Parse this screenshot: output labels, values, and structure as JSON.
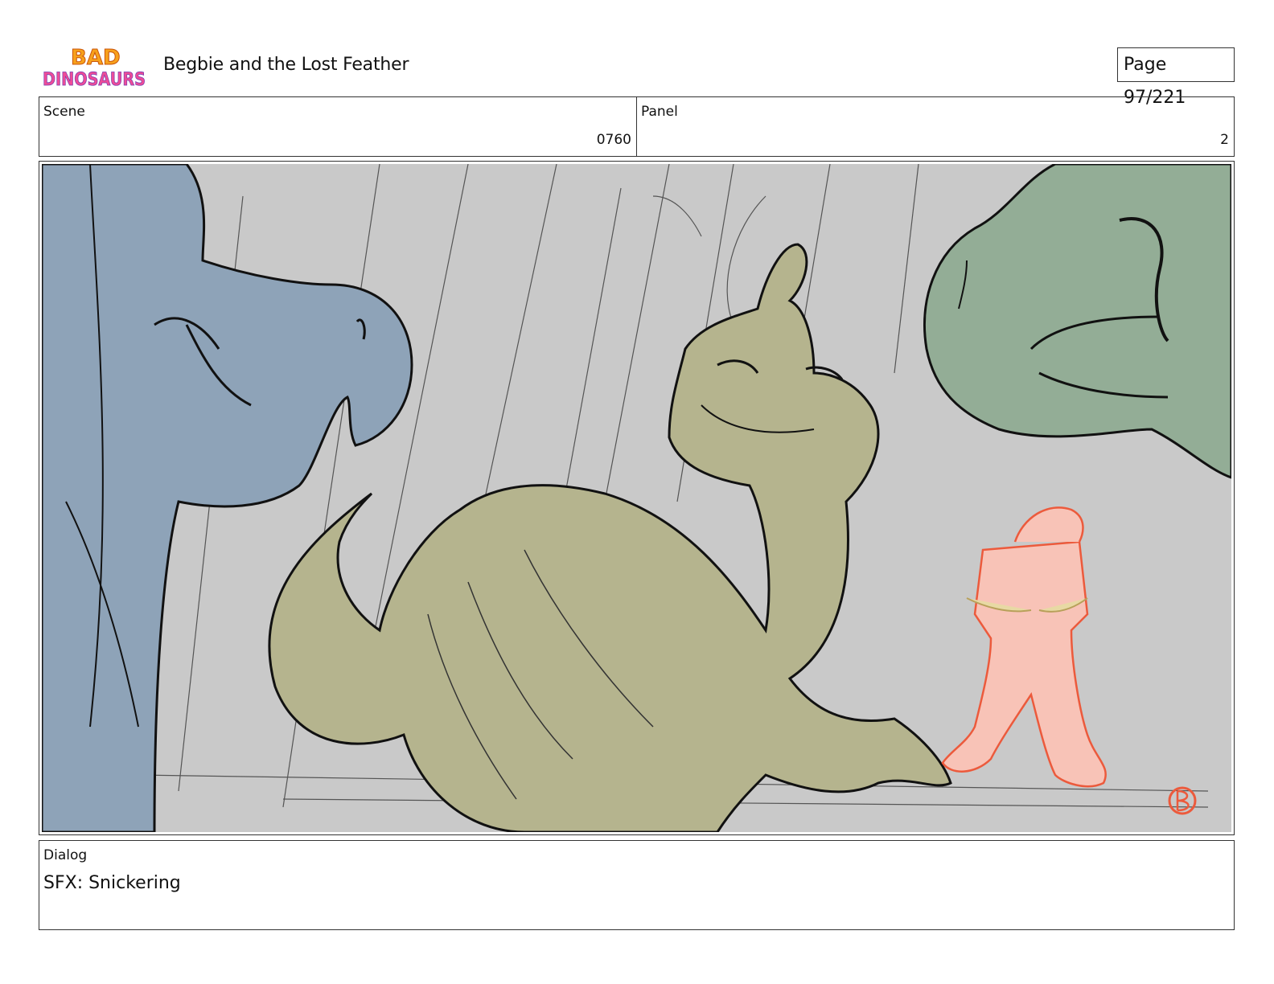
{
  "header": {
    "logo_text_top": "BAD",
    "logo_text_bottom": "DINOSAURS",
    "title": "Begbie and the Lost Feather",
    "page": "Page  97/221"
  },
  "info": {
    "scene_label": "Scene",
    "scene_value": "0760",
    "panel_label": "Panel",
    "panel_value": "2"
  },
  "artwork": {
    "colors": {
      "background": "#c9c9c9",
      "blue_dino": "#8ea3b8",
      "green_dino": "#93ad96",
      "olive_dino": "#b5b48e",
      "pink_dino": "#f8c3b7",
      "pink_outline": "#ec5a3c"
    }
  },
  "dialog": {
    "label": "Dialog",
    "text": "SFX: Snickering"
  }
}
